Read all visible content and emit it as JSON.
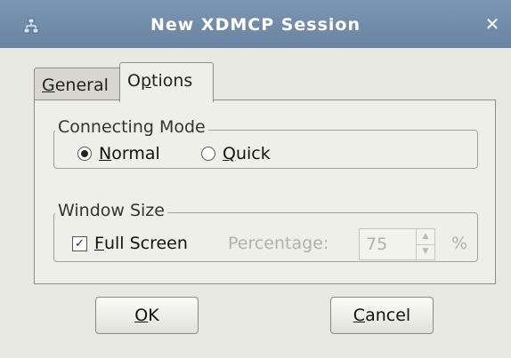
{
  "window": {
    "title": "New XDMCP Session",
    "close_glyph": "✕",
    "icon": "network-icon"
  },
  "tabs": [
    {
      "label_mnemonic": "G",
      "label_rest": "eneral",
      "active": false
    },
    {
      "label_pre": "O",
      "label_mnemonic": "p",
      "label_rest": "tions",
      "active": true
    }
  ],
  "connecting_mode": {
    "legend": "Connecting Mode",
    "options": [
      {
        "mnemonic": "N",
        "rest": "ormal",
        "selected": true
      },
      {
        "mnemonic": "Q",
        "rest": "uick",
        "selected": false
      }
    ]
  },
  "window_size": {
    "legend": "Window Size",
    "full_screen": {
      "mnemonic": "F",
      "rest": "ull Screen",
      "checked": true,
      "check_glyph": "✓"
    },
    "percentage_label": "Percentage:",
    "percentage_value": "75",
    "percent_sign": "%",
    "enabled": false
  },
  "buttons": {
    "ok": {
      "mnemonic": "O",
      "rest": "K"
    },
    "cancel": {
      "mnemonic": "C",
      "rest": "ancel"
    }
  },
  "colors": {
    "titlebar": "#7c97b4",
    "dialog_bg": "#e9e9e4",
    "disabled_text": "#b2b2ab"
  }
}
